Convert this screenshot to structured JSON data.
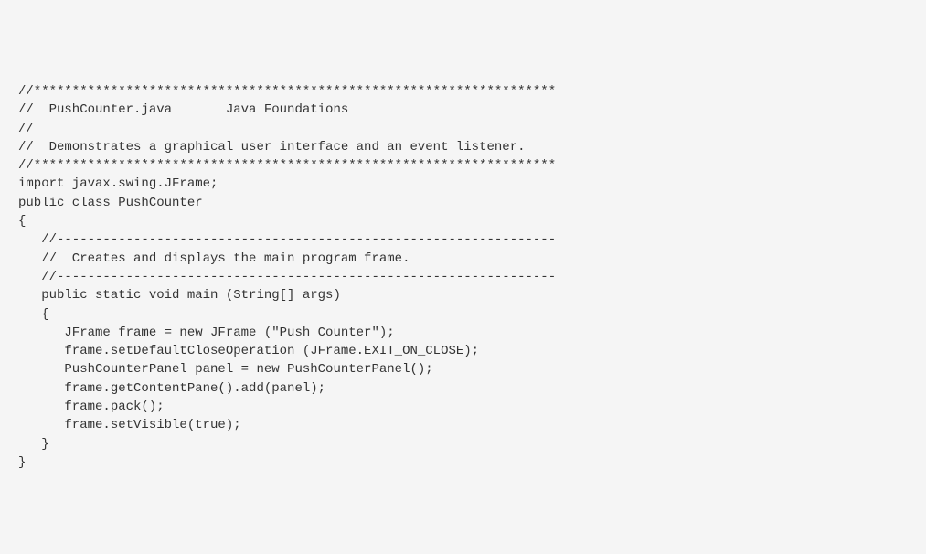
{
  "code": {
    "lines": [
      "//********************************************************************",
      "//  PushCounter.java       Java Foundations",
      "//",
      "//  Demonstrates a graphical user interface and an event listener.",
      "//********************************************************************",
      "",
      "import javax.swing.JFrame;",
      "",
      "public class PushCounter",
      "{",
      "   //-----------------------------------------------------------------",
      "   //  Creates and displays the main program frame.",
      "   //-----------------------------------------------------------------",
      "   public static void main (String[] args)",
      "   {",
      "      JFrame frame = new JFrame (\"Push Counter\");",
      "      frame.setDefaultCloseOperation (JFrame.EXIT_ON_CLOSE);",
      "",
      "      PushCounterPanel panel = new PushCounterPanel();",
      "      frame.getContentPane().add(panel);",
      "",
      "      frame.pack();",
      "      frame.setVisible(true);",
      "   }",
      "}"
    ]
  }
}
